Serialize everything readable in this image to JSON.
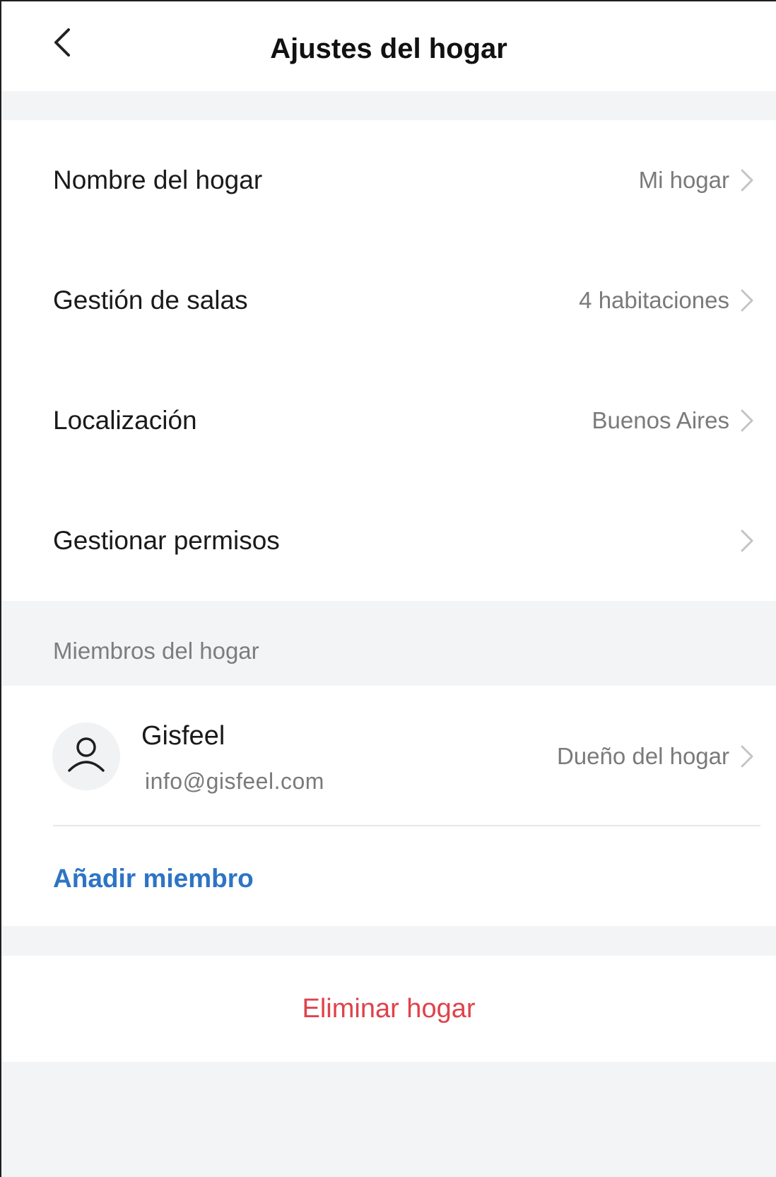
{
  "header": {
    "title": "Ajustes del hogar"
  },
  "settings": [
    {
      "label": "Nombre del hogar",
      "value": "Mi hogar"
    },
    {
      "label": "Gestión de salas",
      "value": "4 habitaciones"
    },
    {
      "label": "Localización",
      "value": "Buenos Aires"
    },
    {
      "label": "Gestionar permisos",
      "value": ""
    }
  ],
  "members": {
    "section_label": "Miembros del hogar",
    "items": [
      {
        "name": "Gisfeel",
        "email": "info@gisfeel.com",
        "role": "Dueño del hogar"
      }
    ],
    "add_label": "Añadir miembro"
  },
  "actions": {
    "delete_label": "Eliminar hogar"
  },
  "colors": {
    "accent": "#2d74c4",
    "danger": "#e0424a",
    "background": "#f3f4f5",
    "secondary_text": "#7a7a7a"
  },
  "icons": {
    "back": "chevron-left-icon",
    "row": "chevron-right-icon",
    "avatar": "user-icon"
  }
}
